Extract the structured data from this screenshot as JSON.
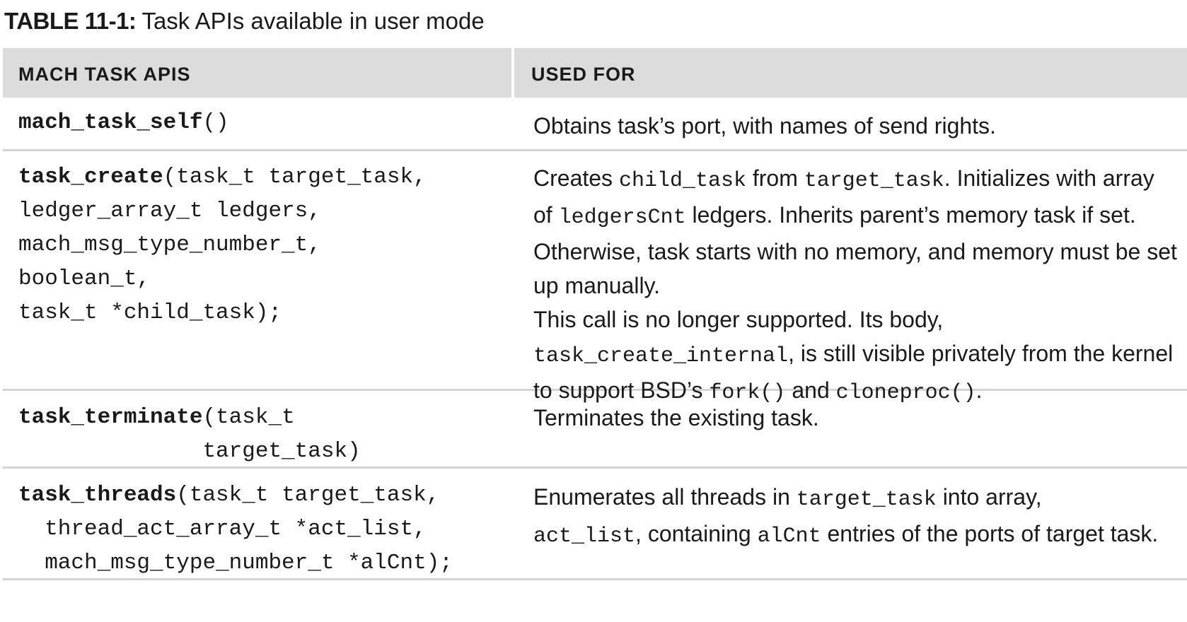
{
  "caption": {
    "label": "TABLE 11-1:",
    "title": "Task APIs available in user mode"
  },
  "table": {
    "headers": [
      "MACH TASK APIS",
      "USED FOR"
    ],
    "rows": [
      {
        "api_name": "mach_task_self",
        "api_args": [
          "()"
        ],
        "used_for": [
          "Obtains task’s port, with names of send rights."
        ]
      },
      {
        "api_name": "task_create",
        "api_args": [
          "(task_t target_task,",
          "ledger_array_t ledgers,",
          "mach_msg_type_number_t,",
          "boolean_t,",
          "task_t *child_task);"
        ],
        "used_for": [
          "Creates",
          "child_task",
          "from",
          "target_task",
          ". Initializes with array of",
          "ledgersCnt",
          "ledgers. Inherits parent’s memory task if set. Otherwise, task starts with no memory, and memory must be set up manually.",
          "This call is no longer supported. Its body,",
          "task_create_internal",
          ", is still visible privately from the kernel to support BSD’s",
          "fork()",
          "and",
          "cloneproc()",
          "."
        ]
      },
      {
        "api_name": "task_terminate",
        "api_args": [
          "(task_t",
          "              target_task)"
        ],
        "used_for": [
          "Terminates the existing task."
        ]
      },
      {
        "api_name": "task_threads",
        "api_args": [
          "(task_t target_task,",
          "  thread_act_array_t *act_list,",
          "  mach_msg_type_number_t *alCnt);"
        ],
        "used_for": [
          "Enumerates all threads in",
          "target_task",
          "into array,",
          "act_list",
          ", containing",
          "alCnt",
          "entries of the ports of target task."
        ]
      }
    ]
  }
}
